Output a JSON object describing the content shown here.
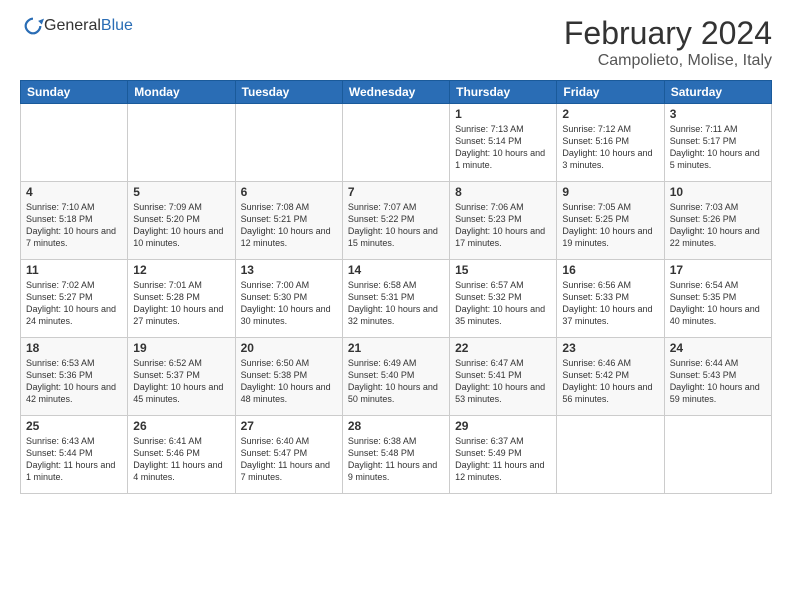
{
  "logo": {
    "general": "General",
    "blue": "Blue"
  },
  "title": "February 2024",
  "location": "Campolieto, Molise, Italy",
  "days_of_week": [
    "Sunday",
    "Monday",
    "Tuesday",
    "Wednesday",
    "Thursday",
    "Friday",
    "Saturday"
  ],
  "weeks": [
    [
      {
        "day": "",
        "info": ""
      },
      {
        "day": "",
        "info": ""
      },
      {
        "day": "",
        "info": ""
      },
      {
        "day": "",
        "info": ""
      },
      {
        "day": "1",
        "sunrise": "7:13 AM",
        "sunset": "5:14 PM",
        "daylight": "10 hours and 1 minute."
      },
      {
        "day": "2",
        "sunrise": "7:12 AM",
        "sunset": "5:16 PM",
        "daylight": "10 hours and 3 minutes."
      },
      {
        "day": "3",
        "sunrise": "7:11 AM",
        "sunset": "5:17 PM",
        "daylight": "10 hours and 5 minutes."
      }
    ],
    [
      {
        "day": "4",
        "sunrise": "7:10 AM",
        "sunset": "5:18 PM",
        "daylight": "10 hours and 7 minutes."
      },
      {
        "day": "5",
        "sunrise": "7:09 AM",
        "sunset": "5:20 PM",
        "daylight": "10 hours and 10 minutes."
      },
      {
        "day": "6",
        "sunrise": "7:08 AM",
        "sunset": "5:21 PM",
        "daylight": "10 hours and 12 minutes."
      },
      {
        "day": "7",
        "sunrise": "7:07 AM",
        "sunset": "5:22 PM",
        "daylight": "10 hours and 15 minutes."
      },
      {
        "day": "8",
        "sunrise": "7:06 AM",
        "sunset": "5:23 PM",
        "daylight": "10 hours and 17 minutes."
      },
      {
        "day": "9",
        "sunrise": "7:05 AM",
        "sunset": "5:25 PM",
        "daylight": "10 hours and 19 minutes."
      },
      {
        "day": "10",
        "sunrise": "7:03 AM",
        "sunset": "5:26 PM",
        "daylight": "10 hours and 22 minutes."
      }
    ],
    [
      {
        "day": "11",
        "sunrise": "7:02 AM",
        "sunset": "5:27 PM",
        "daylight": "10 hours and 24 minutes."
      },
      {
        "day": "12",
        "sunrise": "7:01 AM",
        "sunset": "5:28 PM",
        "daylight": "10 hours and 27 minutes."
      },
      {
        "day": "13",
        "sunrise": "7:00 AM",
        "sunset": "5:30 PM",
        "daylight": "10 hours and 30 minutes."
      },
      {
        "day": "14",
        "sunrise": "6:58 AM",
        "sunset": "5:31 PM",
        "daylight": "10 hours and 32 minutes."
      },
      {
        "day": "15",
        "sunrise": "6:57 AM",
        "sunset": "5:32 PM",
        "daylight": "10 hours and 35 minutes."
      },
      {
        "day": "16",
        "sunrise": "6:56 AM",
        "sunset": "5:33 PM",
        "daylight": "10 hours and 37 minutes."
      },
      {
        "day": "17",
        "sunrise": "6:54 AM",
        "sunset": "5:35 PM",
        "daylight": "10 hours and 40 minutes."
      }
    ],
    [
      {
        "day": "18",
        "sunrise": "6:53 AM",
        "sunset": "5:36 PM",
        "daylight": "10 hours and 42 minutes."
      },
      {
        "day": "19",
        "sunrise": "6:52 AM",
        "sunset": "5:37 PM",
        "daylight": "10 hours and 45 minutes."
      },
      {
        "day": "20",
        "sunrise": "6:50 AM",
        "sunset": "5:38 PM",
        "daylight": "10 hours and 48 minutes."
      },
      {
        "day": "21",
        "sunrise": "6:49 AM",
        "sunset": "5:40 PM",
        "daylight": "10 hours and 50 minutes."
      },
      {
        "day": "22",
        "sunrise": "6:47 AM",
        "sunset": "5:41 PM",
        "daylight": "10 hours and 53 minutes."
      },
      {
        "day": "23",
        "sunrise": "6:46 AM",
        "sunset": "5:42 PM",
        "daylight": "10 hours and 56 minutes."
      },
      {
        "day": "24",
        "sunrise": "6:44 AM",
        "sunset": "5:43 PM",
        "daylight": "10 hours and 59 minutes."
      }
    ],
    [
      {
        "day": "25",
        "sunrise": "6:43 AM",
        "sunset": "5:44 PM",
        "daylight": "11 hours and 1 minute."
      },
      {
        "day": "26",
        "sunrise": "6:41 AM",
        "sunset": "5:46 PM",
        "daylight": "11 hours and 4 minutes."
      },
      {
        "day": "27",
        "sunrise": "6:40 AM",
        "sunset": "5:47 PM",
        "daylight": "11 hours and 7 minutes."
      },
      {
        "day": "28",
        "sunrise": "6:38 AM",
        "sunset": "5:48 PM",
        "daylight": "11 hours and 9 minutes."
      },
      {
        "day": "29",
        "sunrise": "6:37 AM",
        "sunset": "5:49 PM",
        "daylight": "11 hours and 12 minutes."
      },
      {
        "day": "",
        "info": ""
      },
      {
        "day": "",
        "info": ""
      }
    ]
  ],
  "labels": {
    "sunrise": "Sunrise:",
    "sunset": "Sunset:",
    "daylight": "Daylight:"
  }
}
